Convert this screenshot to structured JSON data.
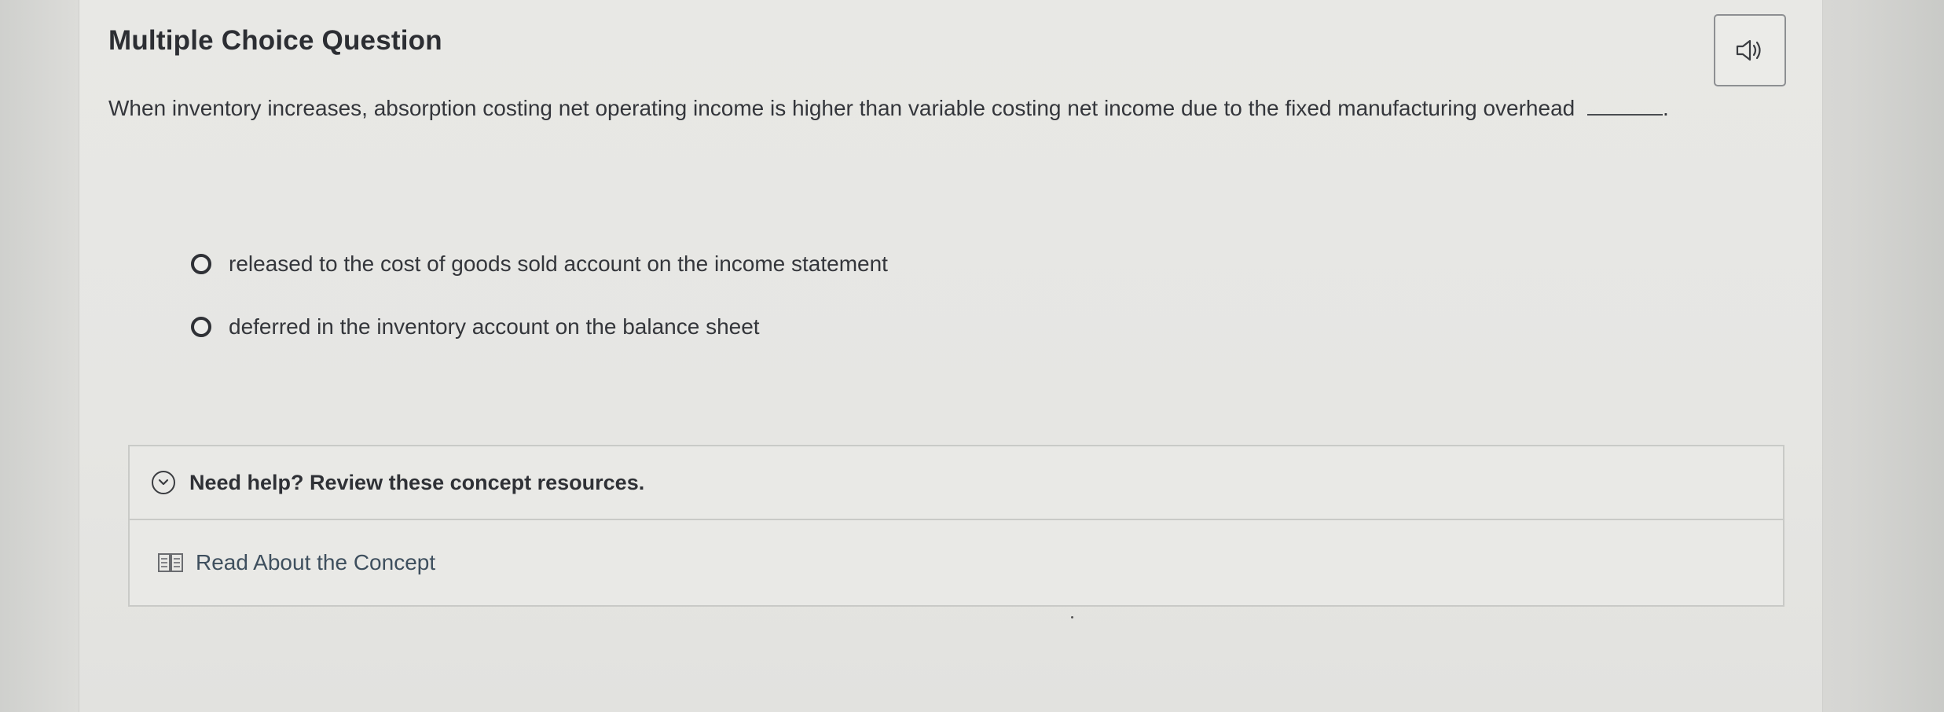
{
  "question_panel": {
    "title": "Multiple Choice Question",
    "audio_icon": "speaker-icon",
    "prompt": "When inventory increases, absorption costing net operating income is higher than variable costing net income due to the fixed manufacturing overhead",
    "prompt_end": "."
  },
  "options": [
    {
      "label": "released to the cost of goods sold account on the income statement",
      "selected": false
    },
    {
      "label": "deferred in the inventory account on the balance sheet",
      "selected": false
    }
  ],
  "help": {
    "toggle_label": "Need help? Review these concept resources.",
    "toggle_icon": "chevron-down-circle-icon",
    "resources": [
      {
        "label": "Read About the Concept",
        "icon": "book-icon"
      }
    ]
  }
}
